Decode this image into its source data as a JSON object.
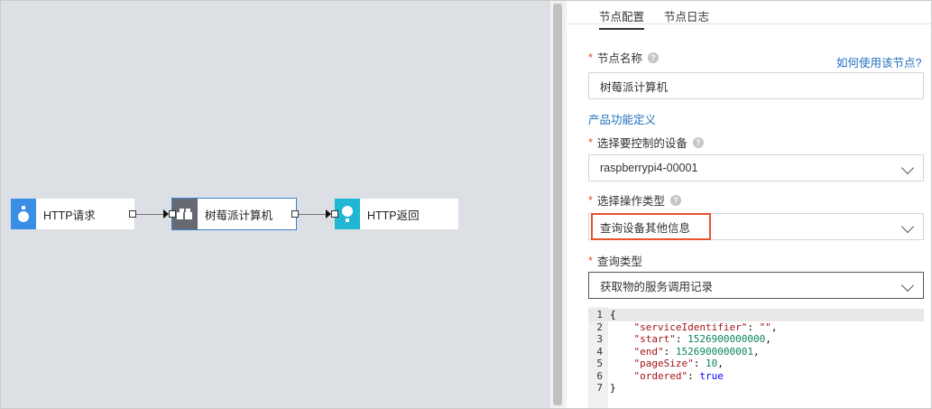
{
  "flow": {
    "nodes": [
      {
        "label": "HTTP请求",
        "icon": "http-request-icon",
        "color": "#3a8ee6"
      },
      {
        "label": "树莓派计算机",
        "icon": "raspberry-device-icon",
        "color": "#666a70"
      },
      {
        "label": "HTTP返回",
        "icon": "http-response-icon",
        "color": "#1fb7d4"
      }
    ]
  },
  "panel": {
    "tabs": [
      {
        "label": "节点配置",
        "active": true
      },
      {
        "label": "节点日志",
        "active": false
      }
    ],
    "node_name": {
      "required": "*",
      "label": "节点名称",
      "help": "?",
      "value": "树莓派计算机"
    },
    "how_to_link": "如何使用该节点?",
    "product_link": "产品功能定义",
    "device": {
      "required": "*",
      "label": "选择要控制的设备",
      "help": "?",
      "value": "raspberrypi4-00001"
    },
    "operation": {
      "required": "*",
      "label": "选择操作类型",
      "help": "?",
      "value": "查询设备其他信息"
    },
    "query_type": {
      "required": "*",
      "label": "查询类型",
      "value": "获取物的服务调用记录"
    },
    "editor": {
      "line_numbers": [
        "1",
        "2",
        "3",
        "4",
        "5",
        "6",
        "7"
      ],
      "open_brace": "{",
      "close_brace": "}",
      "entries": [
        {
          "key": "\"serviceIdentifier\"",
          "value": "\"\"",
          "type": "string",
          "comma": ","
        },
        {
          "key": "\"start\"",
          "value": "1526900000000",
          "type": "number",
          "comma": ","
        },
        {
          "key": "\"end\"",
          "value": "1526900000001",
          "type": "number",
          "comma": ","
        },
        {
          "key": "\"pageSize\"",
          "value": "10",
          "type": "number",
          "comma": ","
        },
        {
          "key": "\"ordered\"",
          "value": "true",
          "type": "bool",
          "comma": ""
        }
      ]
    }
  },
  "colors": {
    "accent": "#1f6fbf",
    "required": "#e0492f",
    "highlight": "#e5532f"
  }
}
